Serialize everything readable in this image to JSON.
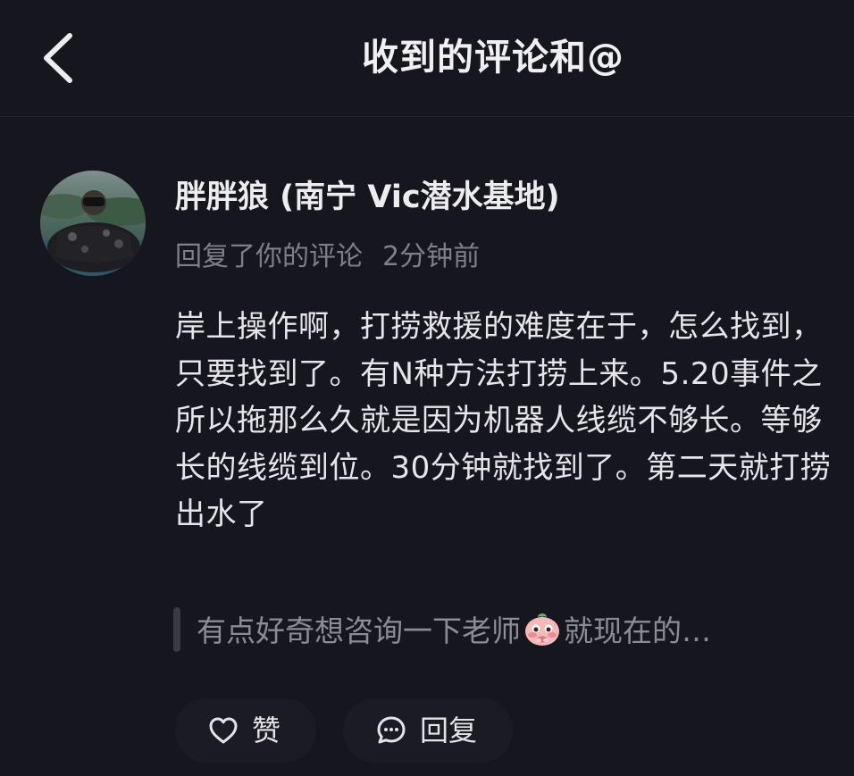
{
  "header": {
    "title": "收到的评论和@",
    "back_icon": "chevron-left-icon"
  },
  "notification": {
    "avatar_icon": "avatar-diver-photo",
    "username": "胖胖狼 (南宁 Vic潜水基地)",
    "action_text": "回复了你的评论",
    "time_text": "2分钟前",
    "comment_text": "岸上操作啊，打捞救援的难度在于，怎么找到，只要找到了。有N种方法打捞上来。5.20事件之所以拖那么久就是因为机器人线缆不够长。等够长的线缆到位。30分钟就找到了。第二天就打捞出水了",
    "quoted_text_before": "有点好奇想咨询一下老师",
    "quoted_emoji": "shy-face-emoji",
    "quoted_text_after": "就现在的…"
  },
  "actions": {
    "like_label": "赞",
    "like_icon": "heart-outline-icon",
    "reply_label": "回复",
    "reply_icon": "chat-bubble-icon"
  },
  "colors": {
    "background": "#16161e",
    "primary_text": "#e9e9ec",
    "secondary_text": "#7f7f89",
    "quote_text": "#8c8c95",
    "button_bg": "#1b1b23"
  }
}
